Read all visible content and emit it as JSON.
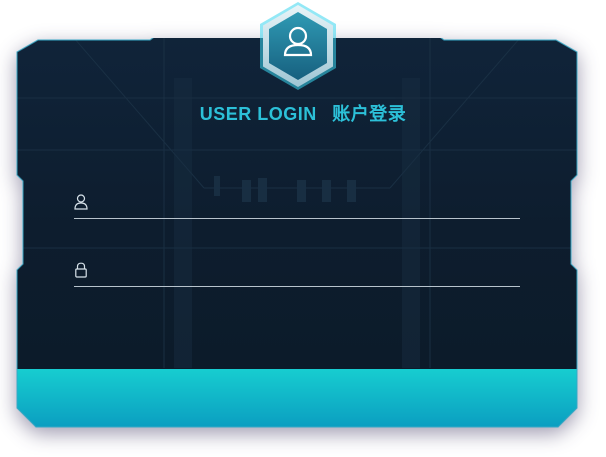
{
  "login": {
    "title_en": "USER LOGIN",
    "title_cn": "账户登录",
    "username": {
      "value": "",
      "placeholder": ""
    },
    "password": {
      "value": "",
      "placeholder": ""
    },
    "submit_label": ""
  },
  "icons": {
    "badge": "user-icon",
    "username": "user-outline-icon",
    "password": "lock-icon"
  },
  "colors": {
    "panel_bg": "#0f2031",
    "panel_border": "#37a9c7",
    "title": "#2cc0d8",
    "bar_top": "#17c9cf",
    "bar_bottom": "#0a9ec0"
  }
}
